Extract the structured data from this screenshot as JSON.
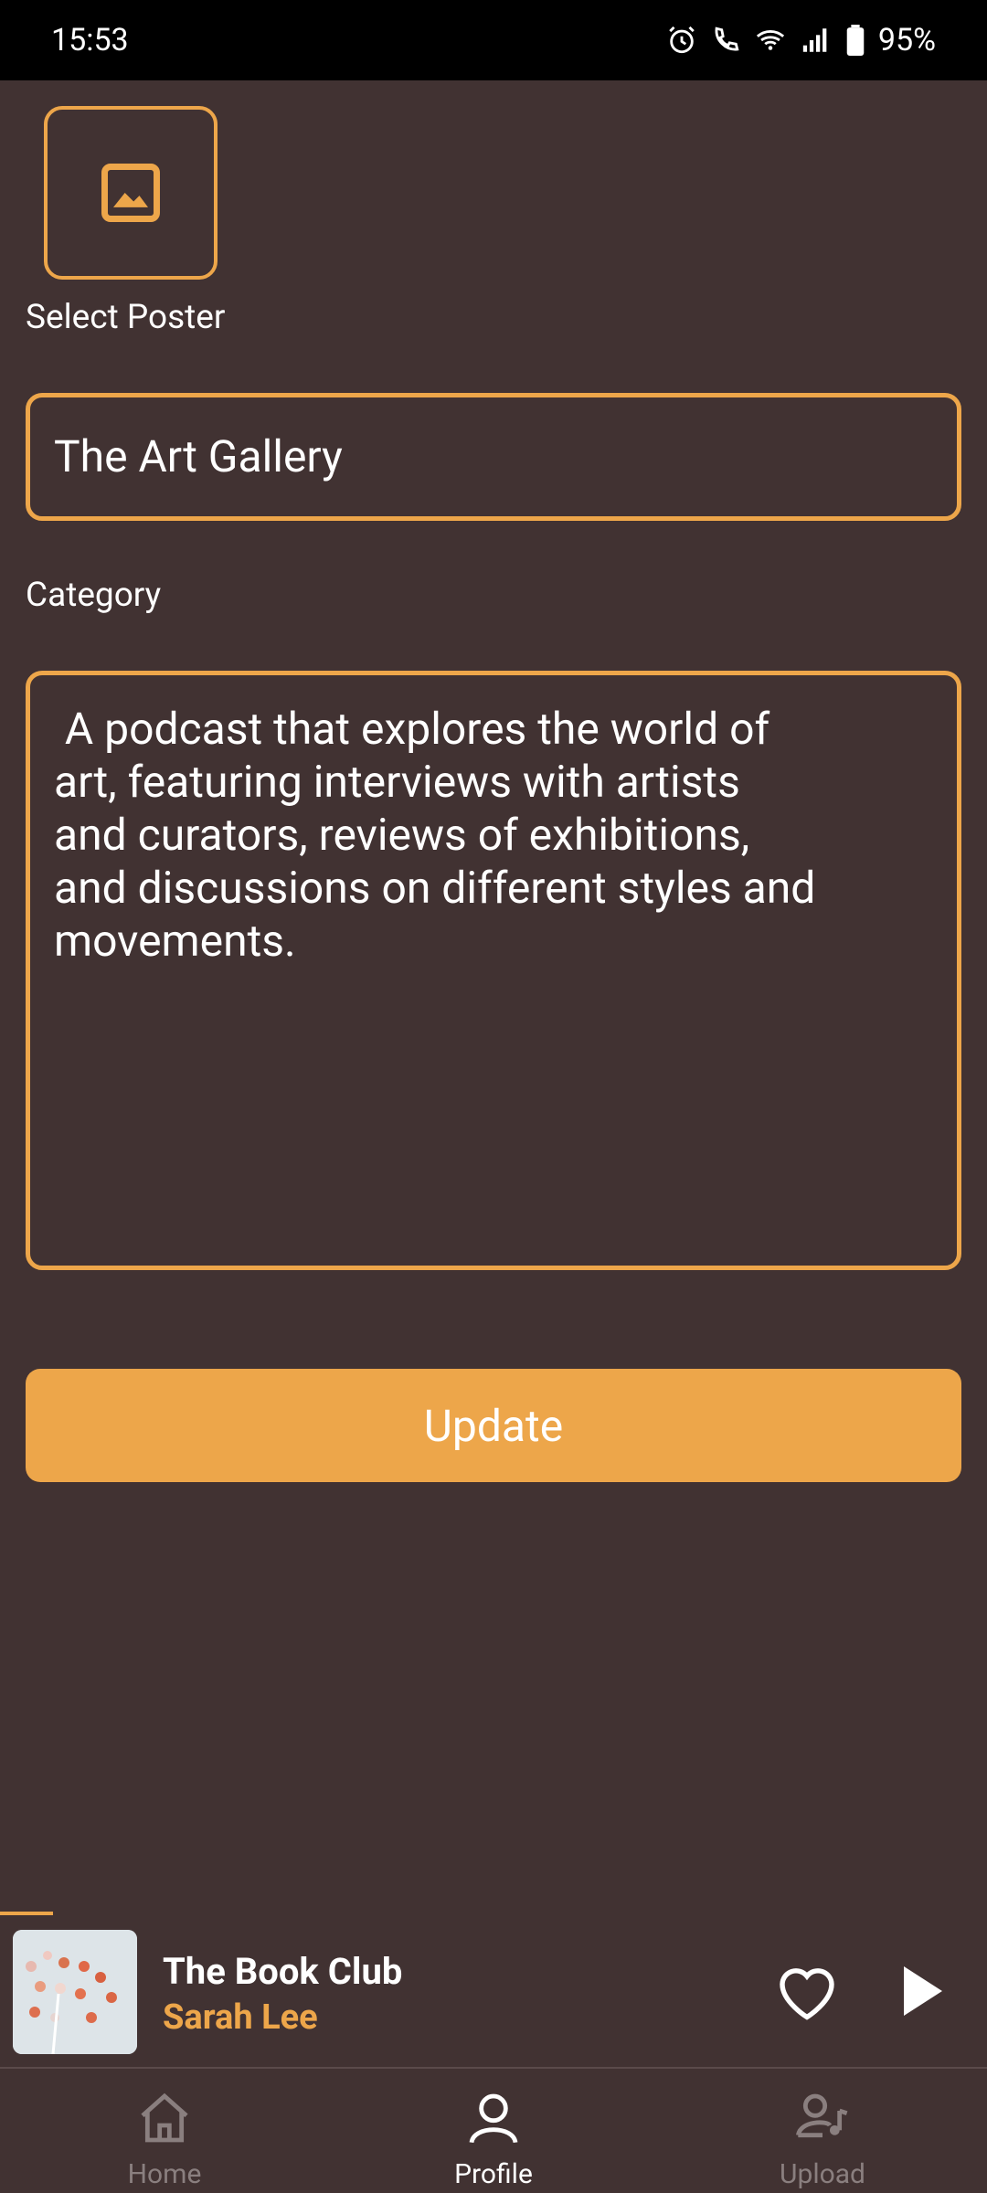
{
  "status_bar": {
    "time": "15:53",
    "battery": "95%"
  },
  "poster": {
    "label": "Select Poster",
    "icon": "image-icon"
  },
  "form": {
    "title_value": "The Art Gallery",
    "category_label": "Category",
    "description_value": " A podcast that explores the world of\nart, featuring interviews with artists\nand curators, reviews of exhibitions,\nand discussions on different styles and\nmovements.",
    "update_label": "Update"
  },
  "mini_player": {
    "title": "The Book Club",
    "artist": "Sarah Lee"
  },
  "nav": [
    {
      "label": "Home",
      "icon": "home-icon"
    },
    {
      "label": "Profile",
      "icon": "profile-icon"
    },
    {
      "label": "Upload",
      "icon": "upload-icon"
    }
  ],
  "colors": {
    "background": "#413232",
    "accent": "#EDA64A"
  }
}
